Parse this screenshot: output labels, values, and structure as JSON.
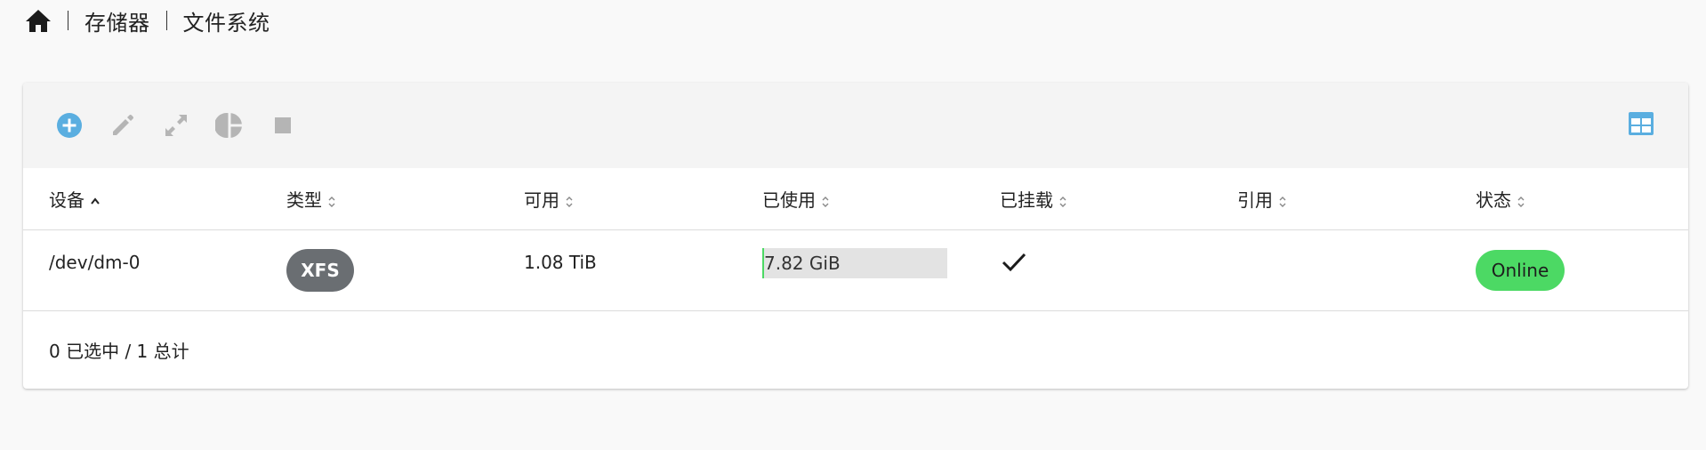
{
  "breadcrumb": {
    "home_icon": "home-icon",
    "items": [
      "存储器",
      "文件系统"
    ]
  },
  "toolbar": {
    "tools": [
      {
        "name": "add-icon",
        "color": "#5aaee0",
        "enabled": true
      },
      {
        "name": "edit-icon",
        "color": "#b5b5b5",
        "enabled": false
      },
      {
        "name": "expand-icon",
        "color": "#b5b5b5",
        "enabled": false
      },
      {
        "name": "pie-chart-icon",
        "color": "#b5b5b5",
        "enabled": false
      },
      {
        "name": "stop-icon",
        "color": "#b5b5b5",
        "enabled": false
      }
    ],
    "view_toggle_icon": "table-view-icon",
    "accent": "#5aaee0"
  },
  "table": {
    "columns": [
      {
        "label": "设备",
        "sort": "asc"
      },
      {
        "label": "类型",
        "sort": "none"
      },
      {
        "label": "可用",
        "sort": "none"
      },
      {
        "label": "已使用",
        "sort": "none"
      },
      {
        "label": "已挂载",
        "sort": "none"
      },
      {
        "label": "引用",
        "sort": "none"
      },
      {
        "label": "状态",
        "sort": "none"
      }
    ],
    "rows": [
      {
        "device": "/dev/dm-0",
        "type": "XFS",
        "available": "1.08 TiB",
        "used": "7.82 GiB",
        "used_fraction": 0.007,
        "mounted": true,
        "references": "",
        "status": "Online"
      }
    ]
  },
  "footer": {
    "summary": "0 已选中 / 1 总计"
  },
  "colors": {
    "status_online": "#4cd964",
    "type_badge": "#6a6e72",
    "usage_track": "#e3e3e3"
  }
}
